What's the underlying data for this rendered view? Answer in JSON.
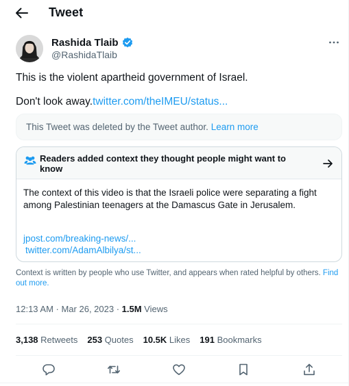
{
  "header": {
    "back_icon": "arrow-left-icon",
    "title": "Tweet"
  },
  "author": {
    "name": "Rashida Tlaib",
    "handle": "@RashidaTlaib",
    "verified_icon": "verified-badge-icon",
    "more_icon": "more-dots-icon"
  },
  "tweet": {
    "line1": "This is the violent apartheid government of Israel.",
    "line2_text": "Don't look away.",
    "line2_link": "twitter.com/theIMEU/status..."
  },
  "deleted_notice": {
    "text": "This Tweet was deleted by the Tweet author.",
    "link": "Learn more"
  },
  "community_note": {
    "icon": "people-icon",
    "title": "Readers added context they thought people might want to know",
    "arrow_icon": "arrow-right-icon",
    "body": "The context of this video is that the Israeli police were separating a fight among Palestinian teenagers at the Damascus Gate in Jerusalem.",
    "links": [
      "jpost.com/breaking-news/...",
      "twitter.com/AdamAlbilya/st..."
    ]
  },
  "context_info": {
    "text": "Context is written by people who use Twitter, and appears when rated helpful by others.",
    "link": "Find out more."
  },
  "meta": {
    "time": "12:13 AM · Mar 26, 2023 · ",
    "views_count": "1.5M",
    "views_label": " Views"
  },
  "stats": {
    "retweets_count": "3,138",
    "retweets_label": " Retweets",
    "quotes_count": "253",
    "quotes_label": " Quotes",
    "likes_count": "10.5K",
    "likes_label": " Likes",
    "bookmarks_count": "191",
    "bookmarks_label": " Bookmarks"
  },
  "actions": [
    "reply-icon",
    "retweet-icon",
    "like-icon",
    "bookmark-icon",
    "share-icon"
  ],
  "colors": {
    "accent": "#1d9bf0",
    "text": "#0f1419",
    "secondary": "#536471",
    "note_bg": "#f7f9f9",
    "border": "#cfd9de"
  }
}
